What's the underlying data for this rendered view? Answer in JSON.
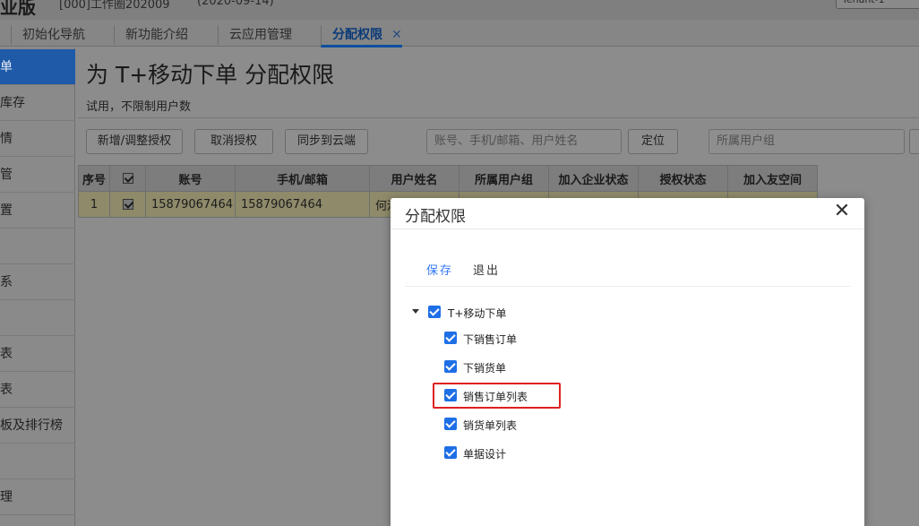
{
  "topbar": {
    "brand": "业版",
    "account": "[000]工作圈202009",
    "date": "(2020-09-14)",
    "user_box": "Tenant-1"
  },
  "tabs": [
    {
      "label": "初始化导航"
    },
    {
      "label": "新功能介绍"
    },
    {
      "label": "云应用管理"
    },
    {
      "label": "分配权限",
      "close": "✕"
    }
  ],
  "nav": {
    "items": [
      "单",
      "库存",
      "情",
      "管",
      "置",
      "",
      "系",
      "",
      "表",
      "表",
      "板及排行榜",
      "",
      "理"
    ]
  },
  "main": {
    "title": "为 T+移动下单 分配权限",
    "subtitle": "试用，不限制用户数",
    "buttons": {
      "add": "新增/调整授权",
      "cancel": "取消授权",
      "sync": "同步到云端",
      "locate": "定位"
    },
    "search_placeholder": "账号、手机/邮箱、用户姓名",
    "group_placeholder": "所属用户组"
  },
  "table": {
    "headers": [
      "序号",
      "",
      "账号",
      "手机/邮箱",
      "用户姓名",
      "所属用户组",
      "加入企业状态",
      "授权状态",
      "加入友空间"
    ],
    "rows": [
      {
        "index": "1",
        "account": "15879067464",
        "phone": "15879067464",
        "name": "何清",
        "group": "",
        "join_status": "",
        "auth_status": "",
        "space": ""
      }
    ]
  },
  "modal": {
    "title": "分配权限",
    "close": "✕",
    "save": "保存",
    "quit": "退出",
    "tree": {
      "root": "T+移动下单",
      "children": [
        "下销售订单",
        "下销货单",
        "销售订单列表",
        "销货单列表",
        "单据设计"
      ]
    }
  },
  "colors": {
    "accent": "#1e6fe6",
    "highlight_box": "#e02020",
    "active_tab": "#0d4f9e"
  }
}
